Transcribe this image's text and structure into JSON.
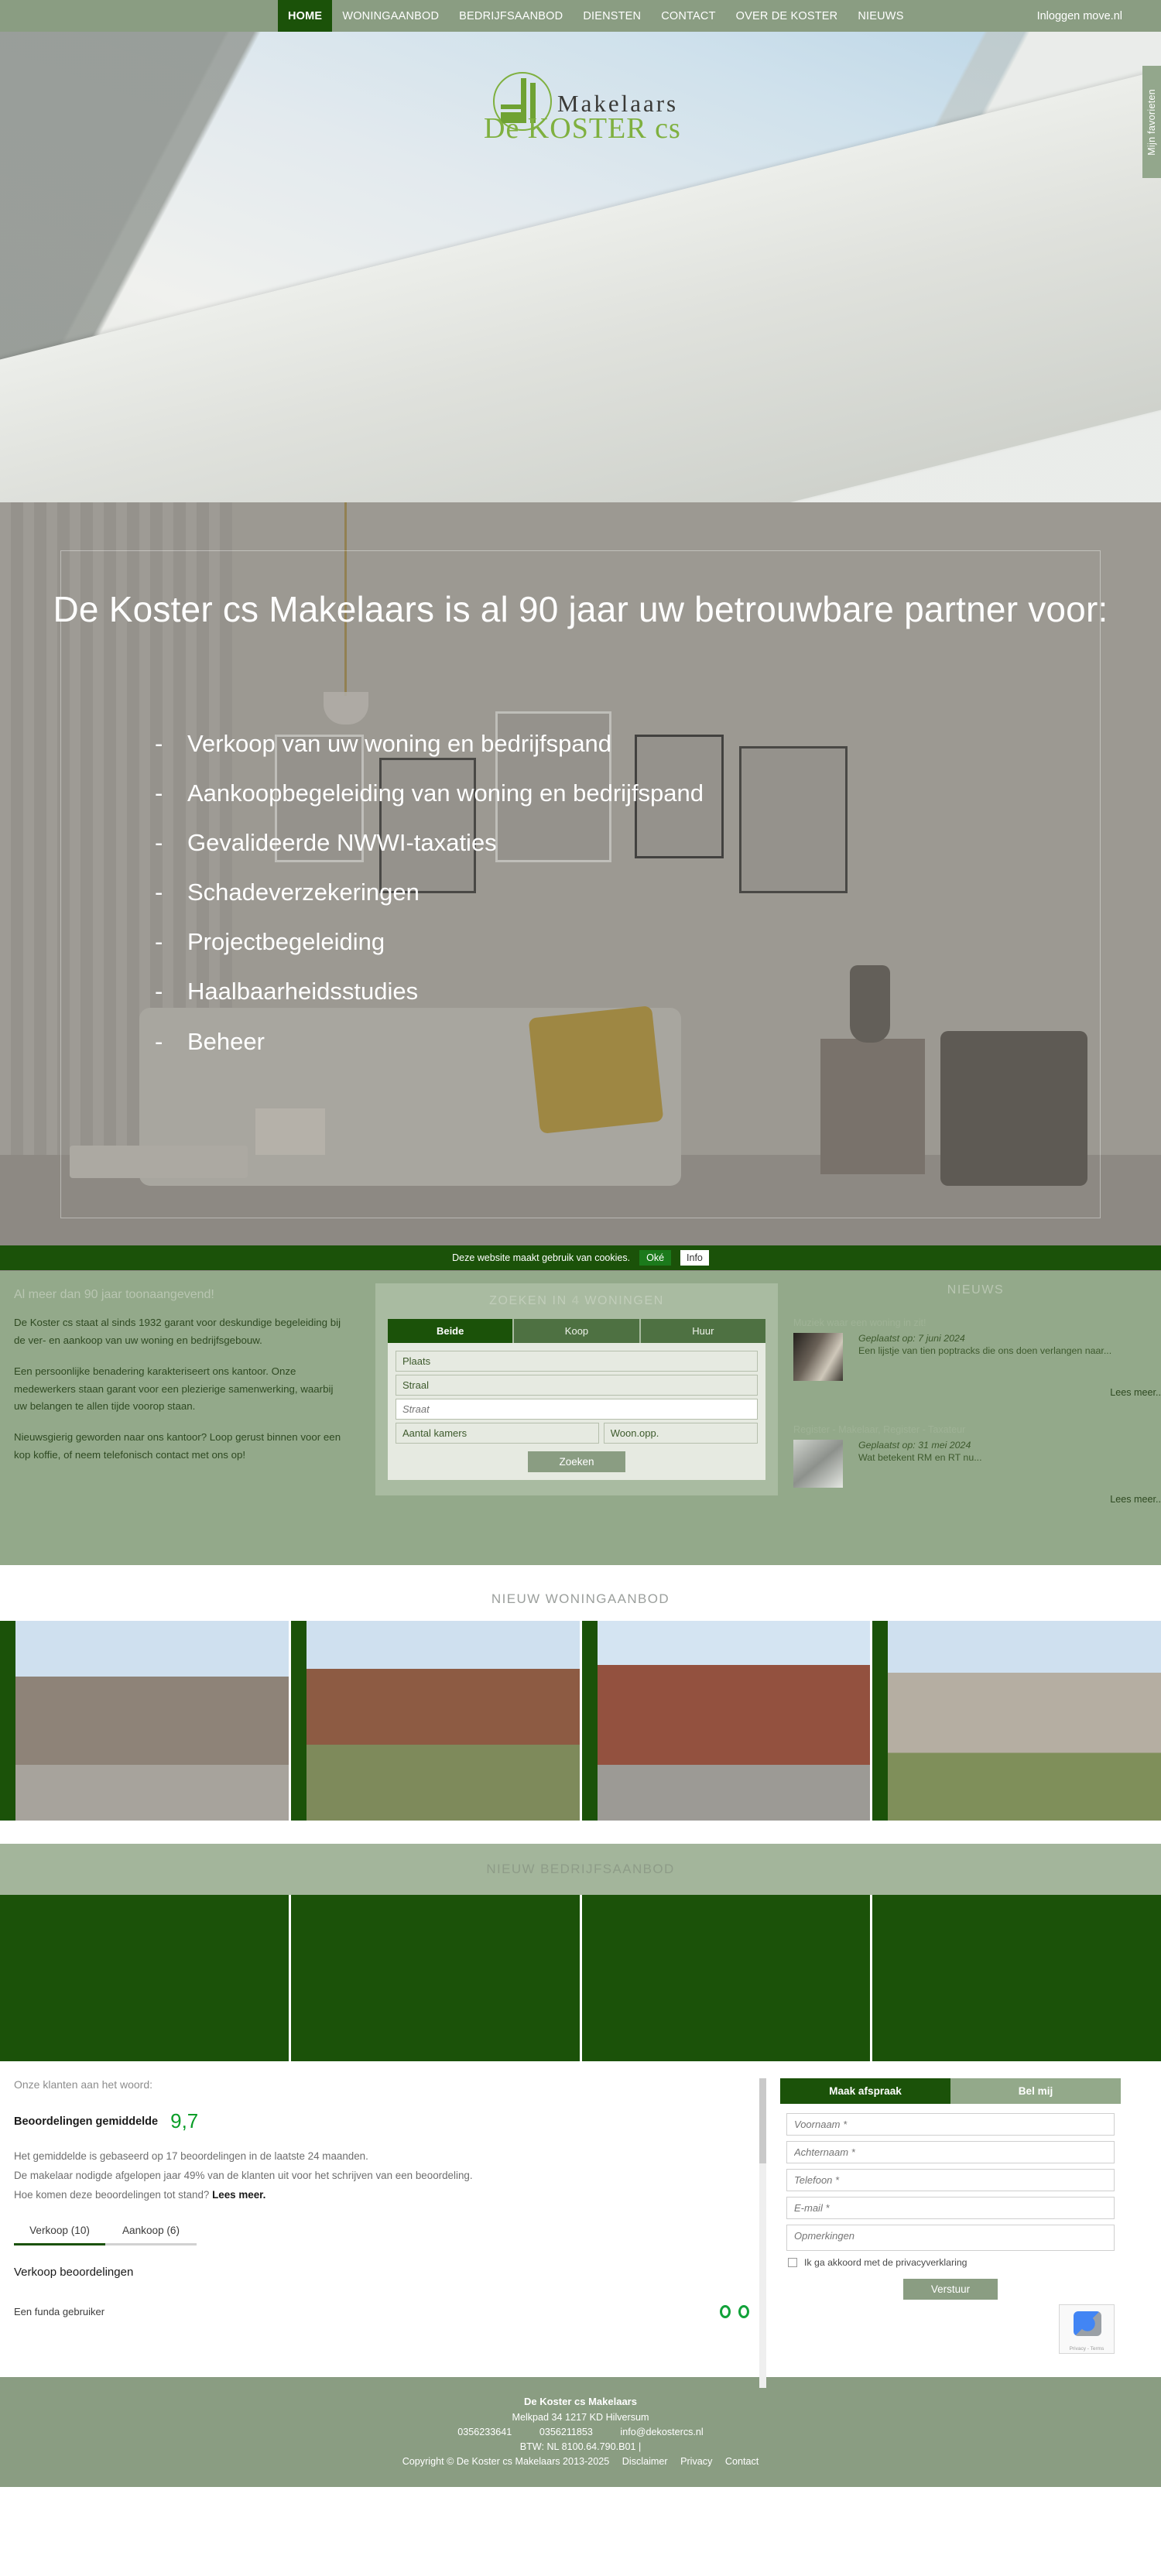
{
  "nav": {
    "items": [
      {
        "label": "HOME",
        "active": true
      },
      {
        "label": "WONINGAANBOD",
        "active": false
      },
      {
        "label": "BEDRIJFSAANBOD",
        "active": false
      },
      {
        "label": "DIENSTEN",
        "active": false
      },
      {
        "label": "CONTACT",
        "active": false
      },
      {
        "label": "OVER DE KOSTER",
        "active": false
      },
      {
        "label": "NIEUWS",
        "active": false
      }
    ],
    "login_label": "Inloggen move.nl"
  },
  "favorites_tab": {
    "label": "Mijn favorieten"
  },
  "logo": {
    "title": "Makelaars",
    "subtitle": "De KOSTER cs"
  },
  "hero": {
    "title": "De Koster cs Makelaars is al 90 jaar uw betrouwbare partner voor:",
    "services": [
      "Verkoop van uw woning en bedrijfspand",
      "Aankoopbegeleiding van woning en bedrijfspand",
      "Gevalideerde NWWI-taxaties",
      "Schadeverzekeringen",
      "Projectbegeleiding",
      "Haalbaarheidsstudies",
      "Beheer"
    ]
  },
  "cookiebar": {
    "text": "Deze website maakt gebruik van cookies.",
    "ok_label": "Oké",
    "info_label": "Info"
  },
  "about": {
    "heading": "Al meer dan 90 jaar toonaangevend!",
    "p1": "De Koster cs staat al sinds 1932 garant voor deskundige begeleiding bij de ver- en aankoop van uw woning en bedrijfsgebouw.",
    "p2": "Een persoonlijke benadering karakteriseert ons kantoor. Onze medewerkers staan garant voor een plezierige samenwerking, waarbij uw belangen te allen tijde voorop staan.",
    "p3": "Nieuwsgierig geworden naar ons kantoor? Loop gerust binnen voor een kop koffie, of neem telefonisch contact met ons op!"
  },
  "search": {
    "title_prefix": "ZOEKEN IN ",
    "title_count": "4",
    "title_suffix": " WONINGEN",
    "tabs": [
      {
        "label": "Beide",
        "active": true
      },
      {
        "label": "Koop",
        "active": false
      },
      {
        "label": "Huur",
        "active": false
      }
    ],
    "plaats_value": "Plaats",
    "straal_value": "Straal",
    "straat_placeholder": "Straat",
    "kamers_value": "Aantal kamers",
    "woonopp_value": "Woon.opp.",
    "submit_label": "Zoeken"
  },
  "news": {
    "title": "NIEUWS",
    "items": [
      {
        "heading": "Muziek waar een woning in zit!",
        "date": "Geplaatst op: 7 juni 2024",
        "snippet": "Een lijstje van tien poptracks die ons doen verlangen naar...",
        "more": "Lees meer.."
      },
      {
        "heading": "Register - Makelaar, Register - Taxateur",
        "date": "Geplaatst op: 31 mei 2024",
        "snippet": "Wat betekent RM en RT nu...",
        "more": "Lees meer.."
      }
    ]
  },
  "listings": {
    "title": "NIEUW WONINGAANBOD",
    "items": [
      {
        "name": "listing-photo-1"
      },
      {
        "name": "listing-photo-2"
      },
      {
        "name": "listing-photo-3"
      },
      {
        "name": "listing-photo-4"
      }
    ]
  },
  "business": {
    "title": "NIEUW BEDRIJFSAANBOD",
    "items": [
      {
        "name": "business-photo-1"
      },
      {
        "name": "business-photo-2"
      },
      {
        "name": "business-photo-3"
      },
      {
        "name": "business-photo-4"
      }
    ]
  },
  "reviews": {
    "lead": "Onze klanten aan het woord:",
    "avg_label": "Beoordelingen gemiddelde",
    "avg_value": "9,7",
    "note_line1": "Het gemiddelde is gebaseerd op 17 beoordelingen in de laatste 24 maanden.",
    "note_line2": "De makelaar nodigde afgelopen jaar 49% van de klanten uit voor het schrijven van een beoordeling.",
    "note_line3_q": "Hoe komen deze beoordelingen tot stand? ",
    "note_line3_link": "Lees meer.",
    "tabs": [
      {
        "label": "Verkoop (10)",
        "active": true
      },
      {
        "label": "Aankoop (6)",
        "active": false
      }
    ],
    "subtitle": "Verkoop beoordelingen",
    "first_user": "Een funda gebruiker"
  },
  "contact_form": {
    "tabs": [
      {
        "label": "Maak afspraak",
        "active": true
      },
      {
        "label": "Bel mij",
        "active": false
      }
    ],
    "voornaam_placeholder": "Voornaam *",
    "achternaam_placeholder": "Achternaam *",
    "telefoon_placeholder": "Telefoon *",
    "email_placeholder": "E-mail *",
    "opmerkingen_placeholder": "Opmerkingen",
    "consent_label": "Ik ga akkoord met de privacyverklaring",
    "submit_label": "Verstuur",
    "recaptcha_caption": "Privacy - Terms"
  },
  "footer": {
    "company": "De Koster cs Makelaars",
    "address": "Melkpad 34   1217 KD Hilversum",
    "phone1": "0356233641",
    "phone2": "0356211853",
    "email": "info@dekostercs.nl",
    "btw": "BTW: NL 8100.64.790.B01 |",
    "copyright": "Copyright © De Koster cs Makelaars 2013-2025",
    "link_disclaimer": "Disclaimer",
    "link_privacy": "Privacy",
    "link_contact": "Contact"
  },
  "colors": {
    "brand_green": "#8a9d82",
    "dark_green": "#1b5209",
    "band_green": "#93a98a",
    "accent_score": "#0a9e28"
  }
}
